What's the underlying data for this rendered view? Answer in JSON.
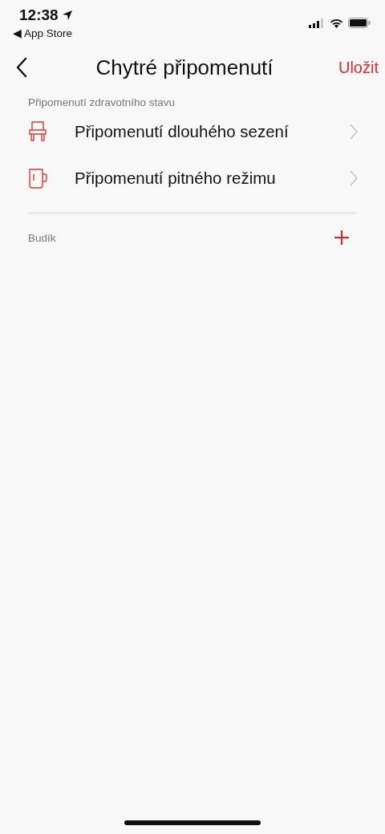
{
  "status_bar": {
    "time": "12:38",
    "back_app": "◀ App Store"
  },
  "nav": {
    "title": "Chytré připomenutí",
    "action": "Uložit"
  },
  "health_section": {
    "label": "Připomenutí zdravotního stavu",
    "items": [
      {
        "kind": "chair",
        "label": "Připomenutí dlouhého sezení"
      },
      {
        "kind": "mug",
        "label": "Připomenutí pitného režimu"
      }
    ]
  },
  "alarm_section": {
    "label": "Budík"
  }
}
